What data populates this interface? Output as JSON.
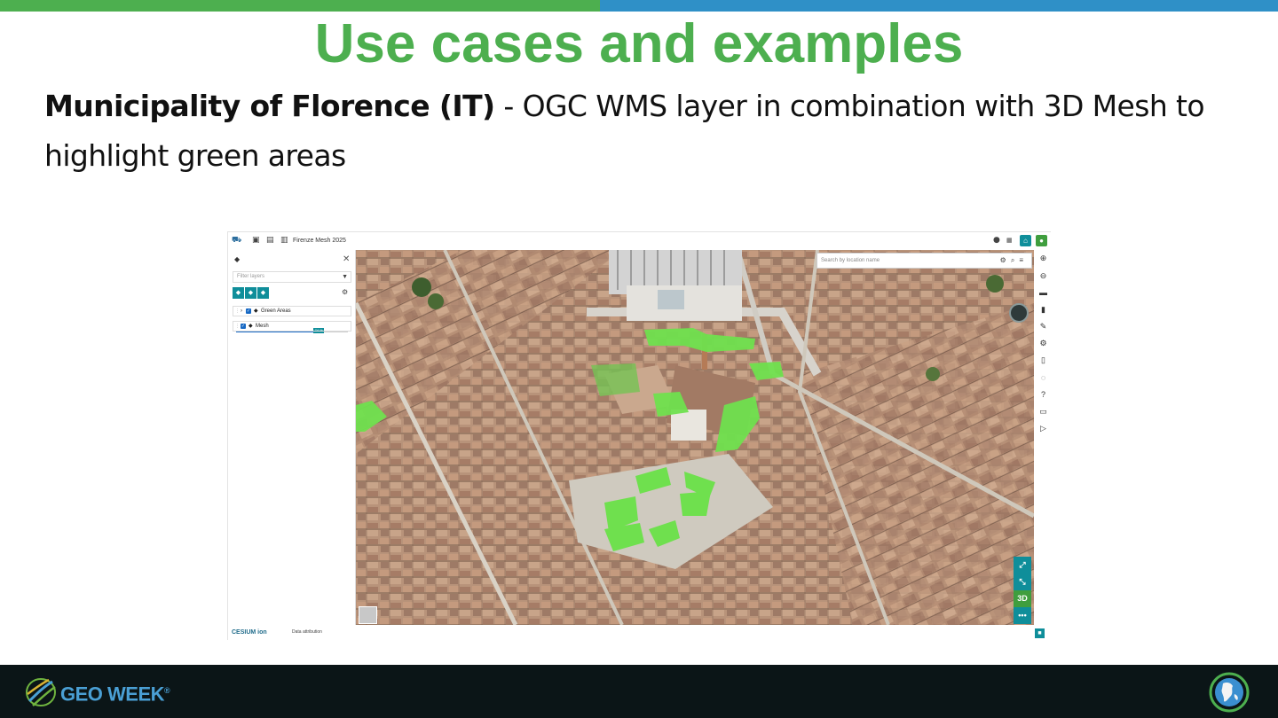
{
  "slide": {
    "title": "Use cases and examples",
    "subtitle_bold": "Municipality of Florence (IT)",
    "subtitle_rest": " - OGC WMS layer in combination with 3D Mesh to highlight green areas",
    "colors": {
      "green": "#4daf4f",
      "blue": "#2f90c7",
      "footer_bg": "#0b1517"
    }
  },
  "app": {
    "map_name": "Firenze Mesh 2025",
    "layers_panel": {
      "filter_placeholder": "Filter layers",
      "layers": [
        {
          "name": "Green Areas",
          "checked": true,
          "opacity_label": "74 %",
          "opacity": 0.74
        },
        {
          "name": "Mesh",
          "checked": true
        }
      ]
    },
    "search_placeholder": "Search by location name",
    "view_mode": "3D",
    "footer": {
      "logo_text": "CESIUM ion",
      "attribution": "Data attribution"
    },
    "accent": "#0f8e9a"
  },
  "footer": {
    "brand": "GEO WEEK",
    "brand_symbol": "®"
  }
}
